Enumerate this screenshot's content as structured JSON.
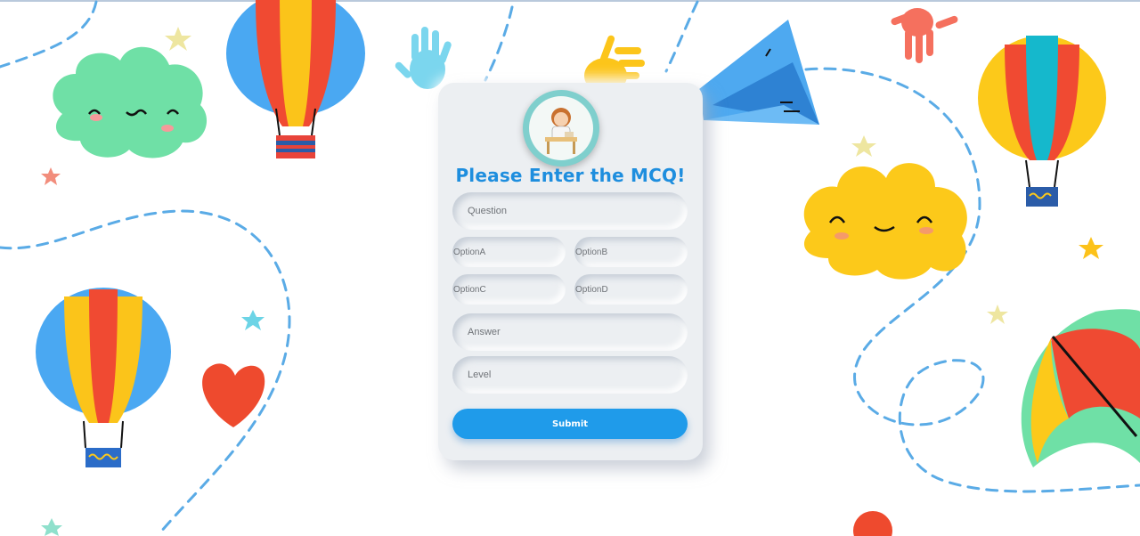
{
  "form": {
    "title": "Please Enter the MCQ!",
    "fields": {
      "question": "Question",
      "option_a": "OptionA",
      "option_b": "OptionB",
      "option_c": "OptionC",
      "option_d": "OptionD",
      "answer": "Answer",
      "level": "Level"
    },
    "submit_label": "Submit"
  },
  "colors": {
    "accent": "#1f9bea",
    "title": "#1e8ede",
    "card": "#eceff2",
    "dash": "#5aabe6"
  },
  "decorations": [
    "hot-air-balloon",
    "cloud",
    "paper-plane",
    "hand",
    "heart",
    "star",
    "umbrella"
  ]
}
